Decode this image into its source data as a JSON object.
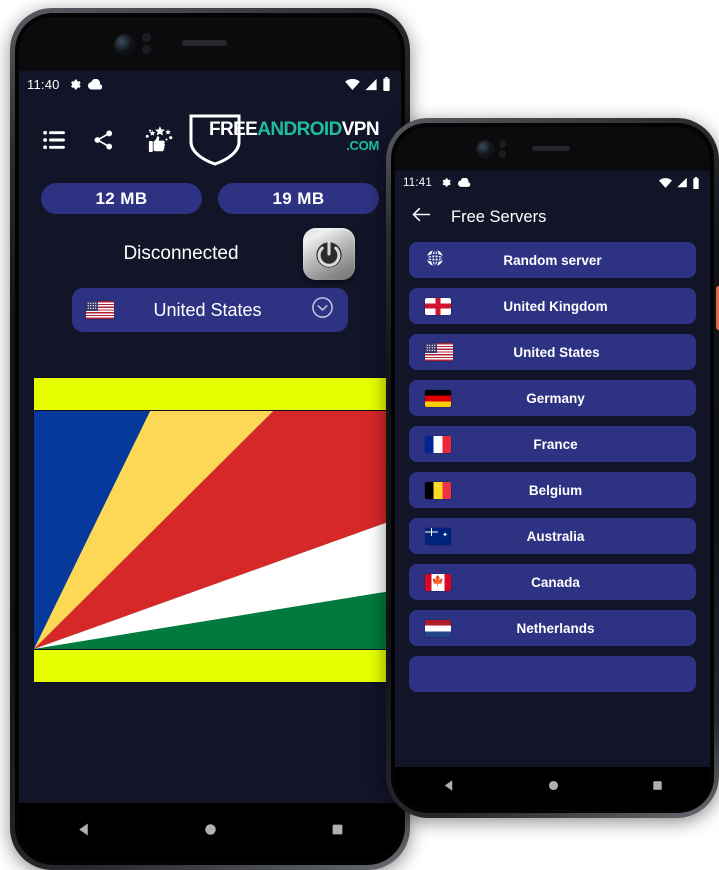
{
  "phone1": {
    "status_bar": {
      "time": "11:40",
      "left_icons": [
        "gear-icon",
        "cloud-icon"
      ],
      "right_icons": [
        "wifi-icon",
        "cellular-signal-icon",
        "battery-icon"
      ]
    },
    "toolbar": {
      "icons": [
        "menu-list-icon",
        "share-icon",
        "rate-us-thumbs-up-icon"
      ]
    },
    "logo": {
      "part1": "FREE",
      "part2": "ANDROID",
      "part3": "VPN",
      "part4": ".COM",
      "white": "#ffffff",
      "teal": "#1fbf9b"
    },
    "traffic": {
      "download": "12 MB",
      "upload": "19 MB"
    },
    "connection": {
      "status": "Disconnected",
      "power_button": "power-toggle"
    },
    "country_selector": {
      "flag": "us-flag",
      "name": "United States",
      "chevron": "chevron-down-circle-icon"
    },
    "ad_banner": {
      "type": "seychelles-flag-banner",
      "bar_color": "#e5ff00",
      "colors": [
        "#07399c",
        "#fcd856",
        "#d62828",
        "#ffffff",
        "#007a3d"
      ]
    },
    "nav_bar": [
      "back-triangle",
      "home-circle",
      "recents-square"
    ]
  },
  "phone2": {
    "status_bar": {
      "time": "11:41",
      "left_icons": [
        "gear-icon",
        "cloud-icon"
      ],
      "right_icons": [
        "wifi-icon",
        "cellular-signal-icon",
        "battery-icon"
      ]
    },
    "app_bar": {
      "back": "back-arrow-icon",
      "title": "Free Servers"
    },
    "servers": [
      {
        "icon": "globe-icon",
        "flag": "globe",
        "name": "Random server"
      },
      {
        "icon": "flag-icon",
        "flag": "uk",
        "name": "United Kingdom"
      },
      {
        "icon": "flag-icon",
        "flag": "us",
        "name": "United States"
      },
      {
        "icon": "flag-icon",
        "flag": "de",
        "name": "Germany"
      },
      {
        "icon": "flag-icon",
        "flag": "fr",
        "name": "France"
      },
      {
        "icon": "flag-icon",
        "flag": "be",
        "name": "Belgium"
      },
      {
        "icon": "flag-icon",
        "flag": "au",
        "name": "Australia"
      },
      {
        "icon": "flag-icon",
        "flag": "ca",
        "name": "Canada"
      },
      {
        "icon": "flag-icon",
        "flag": "nl",
        "name": "Netherlands"
      }
    ],
    "nav_bar": [
      "back-triangle",
      "home-circle",
      "recents-square"
    ],
    "side_power_button_color": "#e8735a"
  },
  "theme": {
    "screen_bg": "#121428",
    "accent_blue": "#2d3282",
    "text_white": "#ffffff"
  }
}
